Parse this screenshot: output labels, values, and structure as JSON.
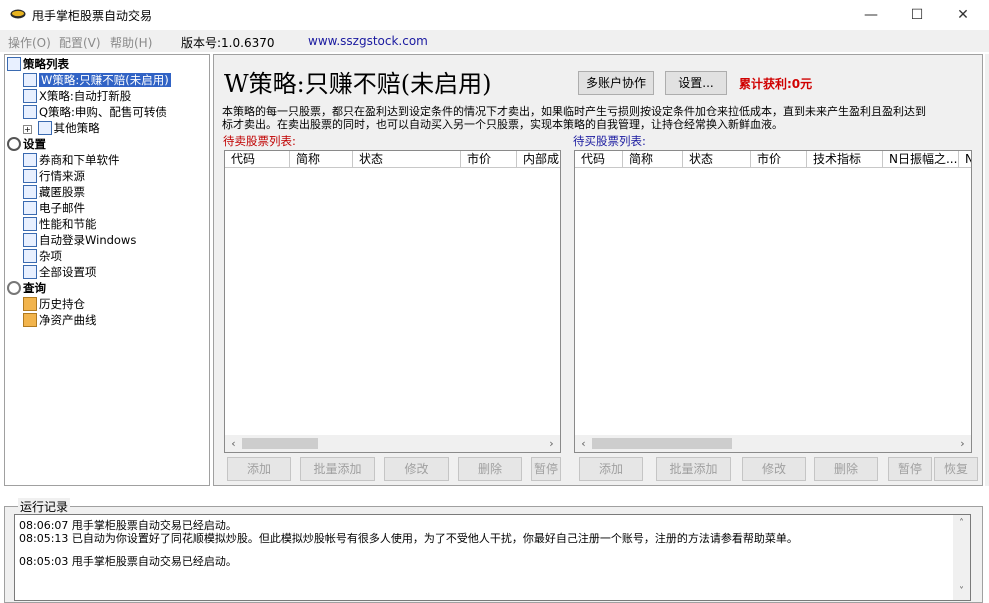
{
  "window": {
    "title": "甩手掌柜股票自动交易",
    "minimize": "—",
    "maximize": "☐",
    "close": "✕"
  },
  "menu": {
    "items": [
      "操作(O)",
      "配置(V)",
      "帮助(H)"
    ],
    "version": "版本号:1.0.6370",
    "website": "www.sszgstock.com"
  },
  "tree": {
    "strategy_header": "策略列表",
    "strategies": [
      "W策略:只赚不赔(未启用)",
      "X策略:自动打新股",
      "Q策略:申购、配售可转债"
    ],
    "expand_glyph": "+",
    "other": "其他策略",
    "settings_header": "设置",
    "settings": [
      "券商和下单软件",
      "行情来源",
      "藏匿股票",
      "电子邮件",
      "性能和节能",
      "自动登录Windows",
      "杂项",
      "全部设置项"
    ],
    "query_header": "查询",
    "queries": [
      "历史持仓",
      "净资产曲线"
    ]
  },
  "main": {
    "strategy_title": "W策略:只赚不赔(未启用)",
    "multi_account_label": "多账户协作",
    "settings_label": "设置...",
    "profit_text": "累计获利:0元",
    "description": "本策略的每一只股票，都只在盈利达到设定条件的情况下才卖出，如果临时产生亏损则按设定条件加仓来拉低成本，直到未来产生盈利且盈利达到\n标才卖出。在卖出股票的同时，也可以自动买入另一个只股票，实现本策略的自我管理，让持仓经常换入新鲜血液。",
    "sell_list": {
      "label": "待卖股票列表:",
      "columns": [
        "代码",
        "简称",
        "状态",
        "市价",
        "内部成"
      ],
      "buttons": [
        "添加",
        "批量添加",
        "修改",
        "删除",
        "暂停"
      ]
    },
    "buy_list": {
      "label": "待买股票列表:",
      "columns": [
        "代码",
        "简称",
        "状态",
        "市价",
        "技术指标",
        "N日振幅之...",
        "N"
      ],
      "buttons": [
        "添加",
        "批量添加",
        "修改",
        "删除",
        "暂停",
        "恢复"
      ]
    }
  },
  "log": {
    "title": "运行记录",
    "lines": [
      "08:06:07 甩手掌柜股票自动交易已经启动。",
      "08:05:13 已自动为你设置好了同花顺模拟炒股。但此模拟炒股帐号有很多人使用，为了不受他人干扰，你最好自己注册一个账号，注册的方法请参看帮助菜单。",
      "08:05:03 甩手掌柜股票自动交易已经启动。"
    ]
  },
  "scroll": {
    "left": "‹",
    "right": "›",
    "up": "˄",
    "down": "˅"
  },
  "colors": {
    "accent_red": "#d00000",
    "link_blue": "#1a1aa0",
    "selection": "#3163c5"
  }
}
